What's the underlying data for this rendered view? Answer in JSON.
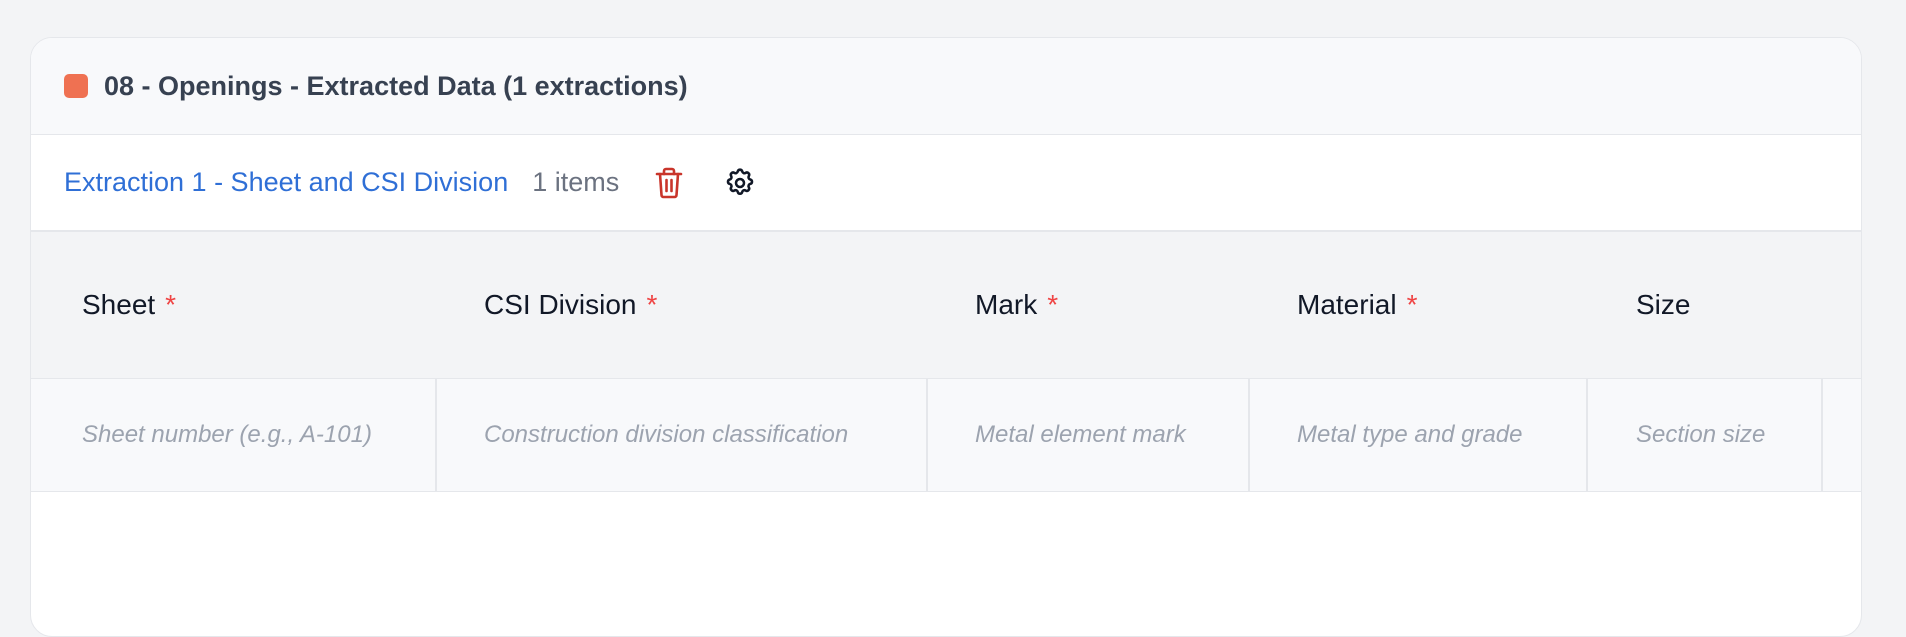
{
  "section": {
    "title": "08 - Openings - Extracted Data (1 extractions)",
    "swatch_color": "#ef7152"
  },
  "extraction": {
    "label": "Extraction 1 - Sheet and CSI Division",
    "count": "1 items",
    "delete_icon": "trash-icon",
    "settings_icon": "gear-icon"
  },
  "columns": [
    {
      "label": "Sheet",
      "required": "*",
      "placeholder": "Sheet number (e.g., A-101)"
    },
    {
      "label": "CSI Division",
      "required": "*",
      "placeholder": "Construction division classification"
    },
    {
      "label": "Mark",
      "required": "*",
      "placeholder": "Metal element mark"
    },
    {
      "label": "Material",
      "required": "*",
      "placeholder": "Metal type and grade"
    },
    {
      "label": "Size",
      "required": "",
      "placeholder": "Section size"
    }
  ],
  "colors": {
    "link": "#2f6fd6",
    "danger": "#c9352b",
    "required": "#ef4444"
  }
}
